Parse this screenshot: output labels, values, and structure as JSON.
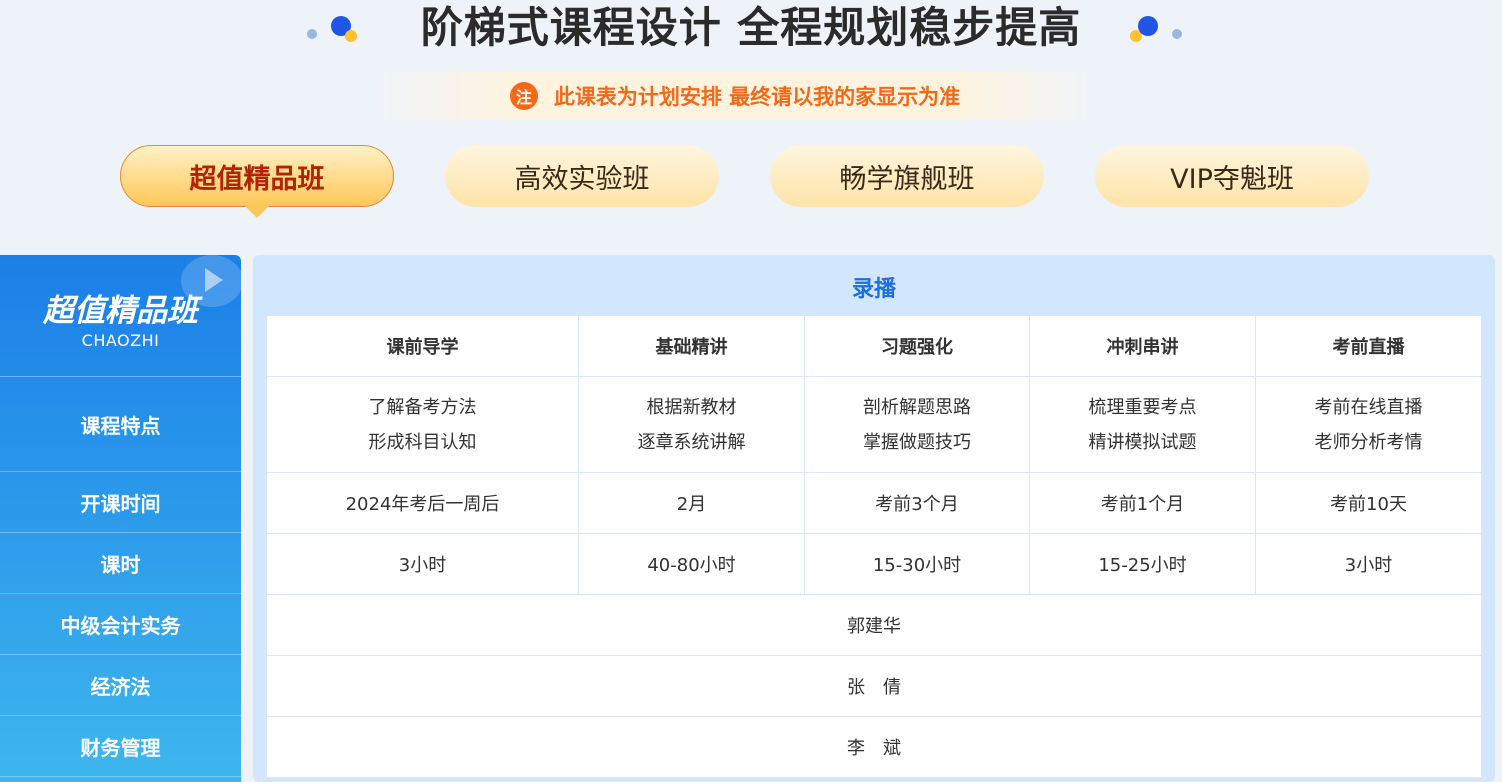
{
  "header": {
    "title": "阶梯式课程设计 全程规划稳步提高",
    "notice_badge": "注",
    "notice_text": "此课表为计划安排 最终请以我的家显示为准"
  },
  "tabs": [
    {
      "label": "超值精品班",
      "active": true
    },
    {
      "label": "高效实验班",
      "active": false
    },
    {
      "label": "畅学旗舰班",
      "active": false
    },
    {
      "label": "VIP夺魁班",
      "active": false
    }
  ],
  "sidebar": {
    "title": "超值精品班",
    "subtitle": "CHAOZHI",
    "rows": [
      "课程特点",
      "开课时间",
      "课时",
      "中级会计实务",
      "经济法",
      "财务管理"
    ]
  },
  "panel": {
    "title": "录播",
    "columns": [
      "课前导学",
      "基础精讲",
      "习题强化",
      "冲刺串讲",
      "考前直播"
    ],
    "features": [
      [
        "了解备考方法",
        "形成科目认知"
      ],
      [
        "根据新教材",
        "逐章系统讲解"
      ],
      [
        "剖析解题思路",
        "掌握做题技巧"
      ],
      [
        "梳理重要考点",
        "精讲模拟试题"
      ],
      [
        "考前在线直播",
        "老师分析考情"
      ]
    ],
    "start_times": [
      "2024年考后一周后",
      "2月",
      "考前3个月",
      "考前1个月",
      "考前10天"
    ],
    "hours": [
      "3小时",
      "40-80小时",
      "15-30小时",
      "15-25小时",
      "3小时"
    ],
    "teachers": [
      "郭建华",
      "张　倩",
      "李　斌"
    ]
  },
  "colors": {
    "accent_blue": "#1b6fe0",
    "notice_orange": "#f26a17",
    "active_tab_text": "#b02305"
  }
}
